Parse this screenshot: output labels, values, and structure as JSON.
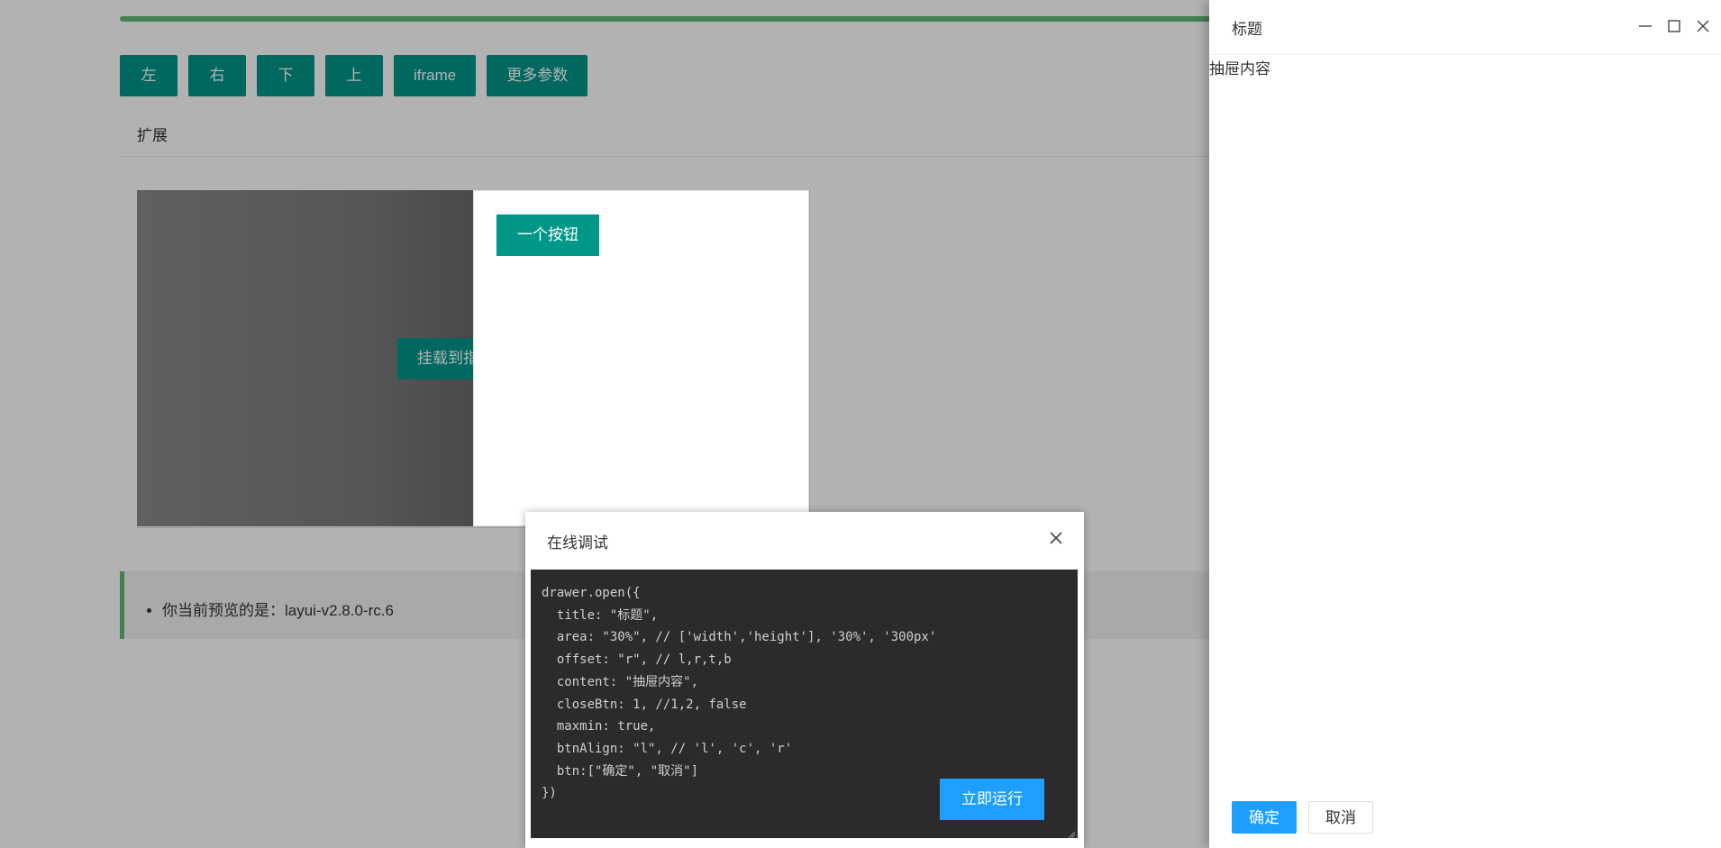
{
  "toolbar": {
    "buttons": [
      "左",
      "右",
      "下",
      "上",
      "iframe",
      "更多参数"
    ]
  },
  "extension": {
    "title": "扩展",
    "mount_button": "挂载到指",
    "inner_button": "一个按钮"
  },
  "notice": {
    "text": "你当前预览的是：layui-v2.8.0-rc.6"
  },
  "debug": {
    "title": "在线调试",
    "close_icon": "close-icon",
    "code_lines": [
      "drawer.open({",
      "  title: \"标题\",",
      "  area: \"30%\", // ['width','height'], '30%', '300px'",
      "  offset: \"r\", // l,r,t,b",
      "  content: \"抽屉内容\",",
      "  closeBtn: 1, //1,2, false",
      "  maxmin: true,",
      "  btnAlign: \"l\", // 'l', 'c', 'r'",
      "  btn:[\"确定\", \"取消\"]",
      "})"
    ],
    "run_button": "立即运行"
  },
  "drawer": {
    "title": "标题",
    "content": "抽屉内容",
    "confirm_button": "确定",
    "cancel_button": "取消",
    "icons": [
      "minimize-icon",
      "maximize-icon",
      "close-icon"
    ]
  },
  "colors": {
    "primary": "#009688",
    "accent_blue": "#1E9FFF",
    "progress_green": "#5FB878",
    "code_bg": "#2b2b2b"
  }
}
